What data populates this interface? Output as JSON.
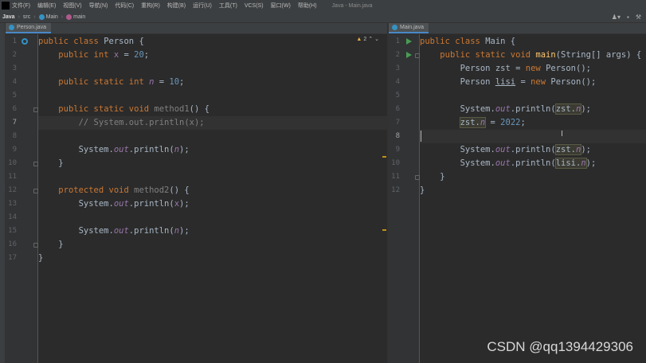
{
  "menubar": {
    "items": [
      "文件(F)",
      "编辑(E)",
      "视图(V)",
      "导航(N)",
      "代码(C)",
      "重构(R)",
      "构建(B)",
      "运行(U)",
      "工具(T)",
      "VCS(S)",
      "窗口(W)",
      "帮助(H)"
    ],
    "window_title": "Java - Main.java"
  },
  "breadcrumb": {
    "project": "Java",
    "folder": "src",
    "cls": "Main",
    "method": "main"
  },
  "left": {
    "tab": "Person.java",
    "warnings": "2",
    "lines": [
      {
        "n": "1",
        "html": "<span class=\"kw\">public class </span>Person {"
      },
      {
        "n": "2",
        "html": "    <span class=\"kw\">public int </span><span class=\"st\" style=\"font-style:normal\">x</span> = <span class=\"num\">20</span>;"
      },
      {
        "n": "3",
        "html": ""
      },
      {
        "n": "4",
        "html": "    <span class=\"kw\">public static int </span><span class=\"st\">n</span> = <span class=\"num\">10</span>;"
      },
      {
        "n": "5",
        "html": ""
      },
      {
        "n": "6",
        "html": "    <span class=\"kw\">public static void </span><span class=\"unused\">method1</span>() {"
      },
      {
        "n": "7",
        "html": "        <span class=\"cm\">// System.out.println(x);</span>"
      },
      {
        "n": "8",
        "html": ""
      },
      {
        "n": "9",
        "html": "        System.<span class=\"st\">out</span>.println(<span class=\"st\">n</span>);"
      },
      {
        "n": "10",
        "html": "    }"
      },
      {
        "n": "11",
        "html": ""
      },
      {
        "n": "12",
        "html": "    <span class=\"kw\">protected void </span><span class=\"unused\">method2</span>() {"
      },
      {
        "n": "13",
        "html": "        System.<span class=\"st\">out</span>.println(<span class=\"st\" style=\"font-style:normal\">x</span>);"
      },
      {
        "n": "14",
        "html": ""
      },
      {
        "n": "15",
        "html": "        System.<span class=\"st\">out</span>.println(<span class=\"st\">n</span>);"
      },
      {
        "n": "16",
        "html": "    }"
      },
      {
        "n": "17",
        "html": "}"
      }
    ]
  },
  "right": {
    "tab": "Main.java",
    "lines": [
      {
        "n": "1",
        "html": "<span class=\"kw\">public class </span>Main {"
      },
      {
        "n": "2",
        "html": "    <span class=\"kw\">public static void </span><span class=\"fnm\">main</span>(String[] args) {"
      },
      {
        "n": "3",
        "html": "        Person zst = <span class=\"kw\">new </span>Person();"
      },
      {
        "n": "4",
        "html": "        Person <u>lisi</u> = <span class=\"kw\">new </span>Person();"
      },
      {
        "n": "5",
        "html": ""
      },
      {
        "n": "6",
        "html": "        System.<span class=\"st\">out</span>.println(<span class=\"hl\">zst.<span class=\"st\">n</span></span>);"
      },
      {
        "n": "7",
        "html": "        <span class=\"hl\">zst.<span class=\"st\">n</span></span> = <span class=\"num\">2022</span>;"
      },
      {
        "n": "8",
        "html": ""
      },
      {
        "n": "9",
        "html": "        System.<span class=\"st\">out</span>.println(<span class=\"hl\">zst.<span class=\"st\">n</span></span>);"
      },
      {
        "n": "10",
        "html": "        System.<span class=\"st\">out</span>.println(<span class=\"hl\">lisi.<span class=\"st\">n</span></span>);"
      },
      {
        "n": "11",
        "html": "    }"
      },
      {
        "n": "12",
        "html": "}"
      }
    ]
  },
  "watermark": "CSDN @qq1394429306"
}
